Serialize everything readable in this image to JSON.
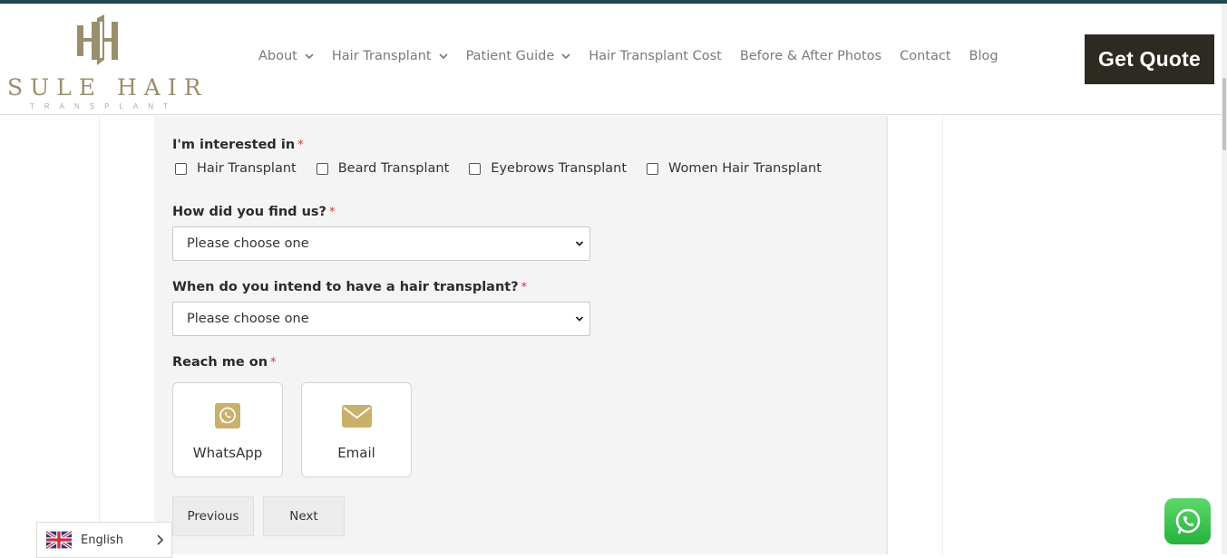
{
  "header": {
    "logo": {
      "name": "SULE HAIR",
      "subtitle": "TRANSPLANT"
    },
    "nav": [
      {
        "label": "About",
        "has_dropdown": true
      },
      {
        "label": "Hair Transplant",
        "has_dropdown": true
      },
      {
        "label": "Patient Guide",
        "has_dropdown": true
      },
      {
        "label": "Hair Transplant Cost",
        "has_dropdown": false
      },
      {
        "label": "Before & After Photos",
        "has_dropdown": false
      },
      {
        "label": "Contact",
        "has_dropdown": false
      },
      {
        "label": "Blog",
        "has_dropdown": false
      }
    ],
    "cta_label": "Get Quote"
  },
  "form": {
    "interested": {
      "label": "I'm interested in",
      "required_mark": "*",
      "options": [
        {
          "label": "Hair Transplant",
          "checked": false
        },
        {
          "label": "Beard Transplant",
          "checked": false
        },
        {
          "label": "Eyebrows Transplant",
          "checked": false
        },
        {
          "label": "Women Hair Transplant",
          "checked": false
        }
      ]
    },
    "find_us": {
      "label": "How did you find us?",
      "required_mark": "*",
      "value": "Please choose one"
    },
    "when": {
      "label": "When do you intend to have a hair transplant?",
      "required_mark": "*",
      "value": "Please choose one"
    },
    "reach": {
      "label": "Reach me on",
      "required_mark": "*",
      "options": [
        {
          "label": "WhatsApp",
          "icon": "whatsapp-icon"
        },
        {
          "label": "Email",
          "icon": "envelope-icon"
        }
      ]
    },
    "previous_label": "Previous",
    "next_label": "Next"
  },
  "language": {
    "label": "English",
    "flag": "uk-flag-icon"
  },
  "colors": {
    "accent_gold": "#c9b06b",
    "logo_gold": "#9a8f6d",
    "cta_bg": "#2d2a22",
    "top_strip": "#22474d",
    "required": "#e0303a",
    "whatsapp_green": "#25b33d"
  }
}
